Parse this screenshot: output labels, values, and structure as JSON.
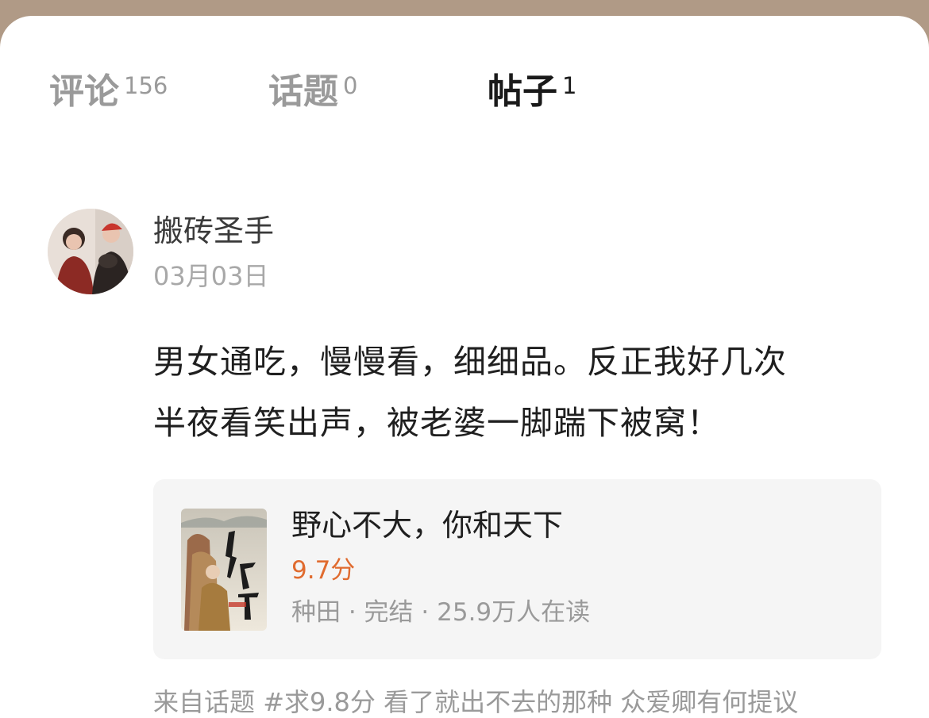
{
  "tabs": [
    {
      "label": "评论",
      "count": "156",
      "active": false
    },
    {
      "label": "话题",
      "count": "0",
      "active": false
    },
    {
      "label": "帖子",
      "count": "1",
      "active": true
    }
  ],
  "post": {
    "username": "搬砖圣手",
    "date": "03月03日",
    "content_line1": "男女通吃，慢慢看，细细品。反正我好几次",
    "content_line2": "半夜看笑出声，被老婆一脚踹下被窝！",
    "book": {
      "title": "野心不大，你和天下",
      "score": "9.7分",
      "meta": "种田 · 完结 · 25.9万人在读",
      "cover_text": "你和天下",
      "cover_subtext": "野心不大"
    },
    "source_prefix": "来自话题",
    "source_topic": "#求9.8分 看了就出不去的那种 众爱卿有何提议"
  },
  "colors": {
    "backdrop": "#b09a86",
    "score": "#e06b2f",
    "muted": "#9a9a9a",
    "card_bg": "#f5f5f5"
  }
}
